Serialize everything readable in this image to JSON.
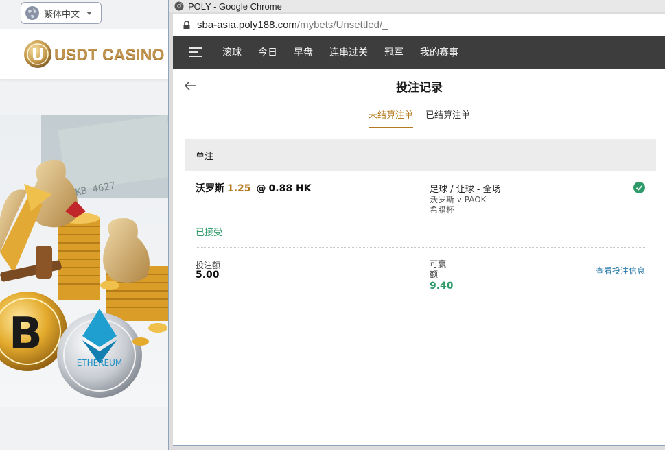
{
  "background_page": {
    "language_selector": {
      "label": "繁体中文"
    },
    "logo": {
      "text": "USDT CASINO"
    },
    "banner": {
      "coin_label": "ETHEREUM"
    }
  },
  "window": {
    "title": "POLY - Google Chrome",
    "url_host": "sba-asia.poly188.com",
    "url_path": "/mybets/Unsettled/_"
  },
  "nav": {
    "items": [
      "滚球",
      "今日",
      "早盘",
      "连串过关",
      "冠军",
      "我的赛事"
    ]
  },
  "page": {
    "title": "投注记录",
    "tabs": [
      {
        "label": "未结算注单",
        "active": true
      },
      {
        "label": "已结算注单",
        "active": false
      }
    ]
  },
  "section": {
    "title": "单注"
  },
  "bet": {
    "selection": "沃罗斯",
    "handicap": "1.25",
    "at": "@",
    "odds": "0.88 HK",
    "market": "足球 / 让球 - 全场",
    "event": "沃罗斯 v PAOK",
    "league": "希腊杯",
    "status": "已接受",
    "stake_label": "投注额",
    "stake_value": "5.00",
    "win_label": "可赢额",
    "win_value": "9.40",
    "detail_link": "查看投注信息"
  },
  "colors": {
    "accent_gold": "#b5791f",
    "accepted_green": "#2e9a6a",
    "nav_bg": "#3d3d3d",
    "link_blue": "#2a7aa8"
  }
}
